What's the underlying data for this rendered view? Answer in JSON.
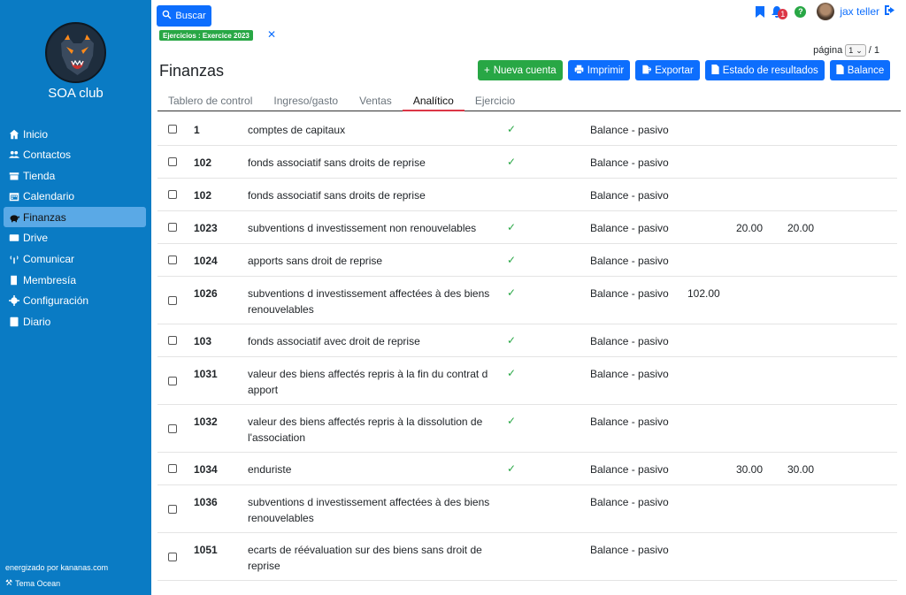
{
  "sidebar": {
    "club_name": "SOA club",
    "items": [
      {
        "label": "Inicio",
        "icon": "home-icon",
        "active": false
      },
      {
        "label": "Contactos",
        "icon": "users-icon",
        "active": false
      },
      {
        "label": "Tienda",
        "icon": "store-icon",
        "active": false
      },
      {
        "label": "Calendario",
        "icon": "calendar-icon",
        "active": false
      },
      {
        "label": "Finanzas",
        "icon": "piggy-bank-icon",
        "active": true
      },
      {
        "label": "Drive",
        "icon": "drive-icon",
        "active": false
      },
      {
        "label": "Comunicar",
        "icon": "broadcast-icon",
        "active": false
      },
      {
        "label": "Membresía",
        "icon": "door-icon",
        "active": false
      },
      {
        "label": "Configuración",
        "icon": "gear-icon",
        "active": false
      },
      {
        "label": "Diario",
        "icon": "journal-icon",
        "active": false
      }
    ],
    "footer_powered": "energizado por kananas.com",
    "footer_theme": "Tema Ocean"
  },
  "search": {
    "label": "Buscar"
  },
  "filter": {
    "badge": "Ejercicios : Exercice 2023"
  },
  "user": {
    "name": "jax teller",
    "notifications": "1",
    "help": "?"
  },
  "pager": {
    "label": "página",
    "current": "1",
    "total": "/ 1"
  },
  "page": {
    "title": "Finanzas"
  },
  "actions": {
    "new_account": "Nueva cuenta",
    "print": "Imprimir",
    "export": "Exportar",
    "income_statement": "Estado de resultados",
    "balance": "Balance"
  },
  "tabs": [
    {
      "label": "Tablero de control",
      "active": false
    },
    {
      "label": "Ingreso/gasto",
      "active": false
    },
    {
      "label": "Ventas",
      "active": false
    },
    {
      "label": "Analítico",
      "active": true
    },
    {
      "label": "Ejercicio",
      "active": false
    }
  ],
  "rows": [
    {
      "code": "1",
      "name": "comptes de capitaux",
      "checked": true,
      "type": "Balance - pasivo",
      "v1": "",
      "v2": "",
      "v3": ""
    },
    {
      "code": "102",
      "name": "fonds associatif sans droits de reprise",
      "checked": true,
      "type": "Balance - pasivo",
      "v1": "",
      "v2": "",
      "v3": ""
    },
    {
      "code": "102",
      "name": "fonds associatif sans droits de reprise",
      "checked": false,
      "type": "Balance - pasivo",
      "v1": "",
      "v2": "",
      "v3": ""
    },
    {
      "code": "1023",
      "name": "subventions d investissement non renouvelables",
      "checked": true,
      "type": "Balance - pasivo",
      "v1": "",
      "v2": "20.00",
      "v3": "20.00"
    },
    {
      "code": "1024",
      "name": "apports sans droit de reprise",
      "checked": true,
      "type": "Balance - pasivo",
      "v1": "",
      "v2": "",
      "v3": ""
    },
    {
      "code": "1026",
      "name": "subventions d investissement affectées à des biens renouvelables",
      "checked": true,
      "type": "Balance - pasivo",
      "v1": "102.00",
      "v2": "",
      "v3": ""
    },
    {
      "code": "103",
      "name": "fonds associatif avec droit de reprise",
      "checked": true,
      "type": "Balance - pasivo",
      "v1": "",
      "v2": "",
      "v3": ""
    },
    {
      "code": "1031",
      "name": "valeur des biens affectés repris à la fin du contrat d apport",
      "checked": true,
      "type": "Balance - pasivo",
      "v1": "",
      "v2": "",
      "v3": ""
    },
    {
      "code": "1032",
      "name": "valeur des biens affectés repris à la dissolution de l'association",
      "checked": true,
      "type": "Balance - pasivo",
      "v1": "",
      "v2": "",
      "v3": ""
    },
    {
      "code": "1034",
      "name": "enduriste",
      "checked": true,
      "type": "Balance - pasivo",
      "v1": "",
      "v2": "30.00",
      "v3": "30.00"
    },
    {
      "code": "1036",
      "name": "subventions d investissement affectées à des biens renouvelables",
      "checked": false,
      "type": "Balance - pasivo",
      "v1": "",
      "v2": "",
      "v3": ""
    },
    {
      "code": "1051",
      "name": "ecarts de réévaluation sur des biens sans droit de reprise",
      "checked": false,
      "type": "Balance - pasivo",
      "v1": "",
      "v2": "",
      "v3": ""
    }
  ],
  "colors": {
    "sidebar": "#0a7bc4",
    "primary": "#0d6efd",
    "success": "#28a745",
    "tab_active": "#dc3545"
  }
}
